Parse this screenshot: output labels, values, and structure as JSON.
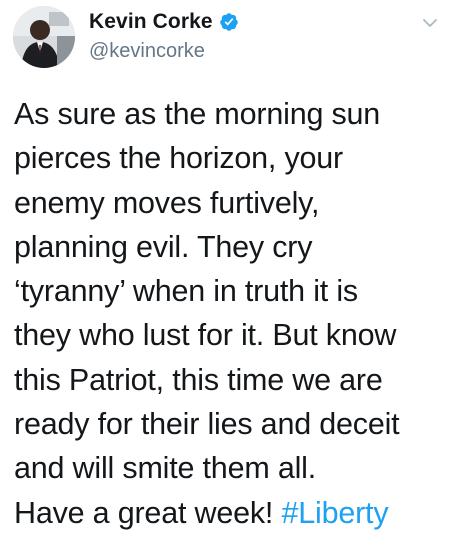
{
  "author": {
    "display_name": "Kevin Corke",
    "handle": "@kevincorke",
    "verified": true
  },
  "tweet": {
    "lines": [
      "As sure as the morning sun",
      "pierces the horizon, your",
      "enemy moves furtively,",
      "planning evil. They cry",
      "‘tyranny’ when in truth it is",
      "they who lust for it. But know",
      "this Patriot, this time we are",
      "ready for their lies and deceit",
      "and will smite them all."
    ],
    "last_line_text": "Have a great week! ",
    "hashtag": "#Liberty"
  },
  "icons": {
    "verified": "verified-badge-icon",
    "menu": "chevron-down-icon"
  },
  "colors": {
    "text": "#14171a",
    "secondary": "#657786",
    "link": "#1da1f2",
    "background": "#ffffff"
  }
}
